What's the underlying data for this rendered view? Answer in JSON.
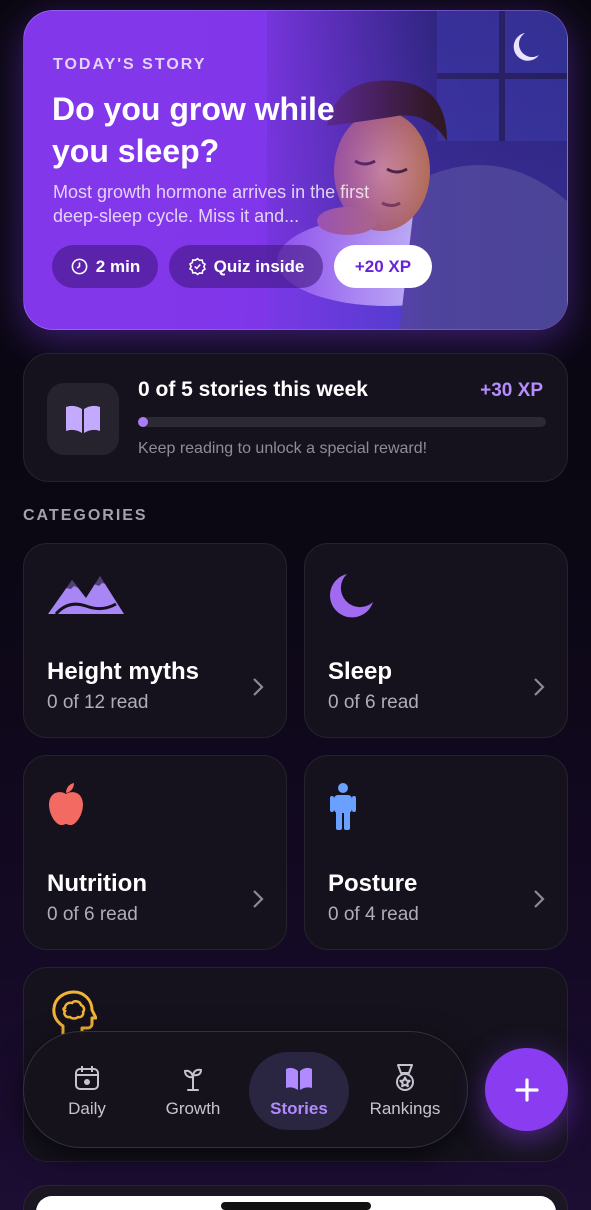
{
  "hero": {
    "kicker": "TODAY'S STORY",
    "title": "Do you grow while you sleep?",
    "description": "Most growth hormone arrives in the first deep-sleep cycle. Miss it and...",
    "chips": [
      {
        "icon": "clock-icon",
        "label": "2 min"
      },
      {
        "icon": "quiz-badge-icon",
        "label": "Quiz inside"
      },
      {
        "label": "+20 XP"
      }
    ]
  },
  "weekly": {
    "icon": "open-book-icon",
    "title": "0 of 5 stories this week",
    "xp": "+30 XP",
    "progress": 0,
    "hint": "Keep reading to unlock a special reward!"
  },
  "categories_label": "CATEGORIES",
  "categories": [
    {
      "name": "Height myths",
      "count": "0 of 12 read",
      "icon": "mountains-icon",
      "color": "#a886f5"
    },
    {
      "name": "Sleep",
      "count": "0 of 6 read",
      "icon": "moon-icon",
      "color": "#a06bf0"
    },
    {
      "name": "Nutrition",
      "count": "0 of 6 read",
      "icon": "apple-icon",
      "color": "#f26a62"
    },
    {
      "name": "Posture",
      "count": "0 of 4 read",
      "icon": "person-icon",
      "color": "#6aa0ff"
    }
  ],
  "partial_category": {
    "icon": "brain-head-icon",
    "color": "#f3b436"
  },
  "nav": {
    "items": [
      {
        "label": "Daily",
        "icon": "calendar-icon"
      },
      {
        "label": "Growth",
        "icon": "sprout-icon"
      },
      {
        "label": "Stories",
        "icon": "open-book-icon",
        "active": true
      },
      {
        "label": "Rankings",
        "icon": "medal-icon"
      }
    ],
    "fab_icon": "plus-icon"
  },
  "colors": {
    "accent": "#8a3cf0",
    "accent_light": "#b08bff",
    "card": "#15121d"
  }
}
